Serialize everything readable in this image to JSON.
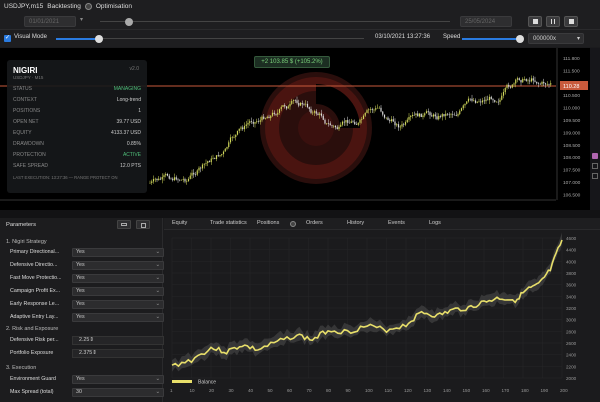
{
  "title": {
    "symbol": "USDJPY,m15",
    "mode": "Backtesting",
    "optimisation": "Optimisation"
  },
  "dates": {
    "start": "01/01/2021",
    "end": "25/05/2024"
  },
  "visual": {
    "label": "Visual Mode",
    "timestamp": "03/10/2021 13:27:36",
    "speed_label": "Speed",
    "speed_value": "000000x"
  },
  "chart": {
    "profit_badge": "+2 103.85 $ (+105.2%)",
    "price_labels": [
      "111.800",
      "111.500",
      "111.000",
      "110.500",
      "110.000",
      "109.500",
      "109.000",
      "108.500",
      "108.000",
      "107.500",
      "107.000",
      "106.500"
    ],
    "current_price": "110.28",
    "time_labels": [
      "2021",
      "",
      "",
      "",
      "",
      "",
      "",
      "",
      "",
      "12:00"
    ]
  },
  "info": {
    "name": "NIGIRI",
    "sub": "USDJPY · M15",
    "version": "v2.0",
    "rows": [
      {
        "k": "STATUS",
        "v": "MANAGING"
      },
      {
        "k": "CONTEXT",
        "v": "Long-trend"
      },
      {
        "k": "POSITIONS",
        "v": "1"
      },
      {
        "k": "OPEN NET",
        "v": "39.77 USD"
      },
      {
        "k": "EQUITY",
        "v": "4133.37 USD"
      },
      {
        "k": "DRAWDOWN",
        "v": "0.85%"
      },
      {
        "k": "PROTECTION",
        "v": "ACTIVE"
      },
      {
        "k": "SAFE SPREAD",
        "v": "12.0 PTS"
      }
    ],
    "footer": "LAST EXECUTION: 13:27:36 — RANGE PROTECT ON"
  },
  "params": {
    "title": "Parameters",
    "section1": "1. Nigiri Strategy",
    "rows1": [
      {
        "label": "Primary Directional...",
        "value": "Yes"
      },
      {
        "label": "Defensive Directio...",
        "value": "Yes"
      },
      {
        "label": "Fast Move Protectio...",
        "value": "Yes"
      },
      {
        "label": "Campaign Profit Ex...",
        "value": "Yes"
      },
      {
        "label": "Early Response Le...",
        "value": "Yes"
      },
      {
        "label": "Adaptive Entry Lay...",
        "value": "Yes"
      }
    ],
    "section2": "2. Risk and Exposure",
    "rows2": [
      {
        "label": "Defensive Risk per...",
        "value": "2.25"
      },
      {
        "label": "Portfolio Exposure",
        "value": "2.375"
      }
    ],
    "section3": "3. Execution",
    "rows3": [
      {
        "label": "Environment Guard",
        "value": "Yes"
      },
      {
        "label": "Max Spread (total)",
        "value": "30"
      }
    ]
  },
  "tabs": [
    "Equity",
    "Trade statistics",
    "Positions",
    "Orders",
    "History",
    "Events",
    "Logs"
  ],
  "equity": {
    "legend": "Balance",
    "y_labels": [
      "4600",
      "4400",
      "4000",
      "3800",
      "3600",
      "3400",
      "3200",
      "3000",
      "2800",
      "2600",
      "2400",
      "2200",
      "2000"
    ],
    "x_labels": [
      "1",
      "10",
      "20",
      "30",
      "40",
      "50",
      "60",
      "70",
      "80",
      "90",
      "100",
      "110",
      "120",
      "130",
      "140",
      "150",
      "160",
      "170",
      "180",
      "190",
      "200"
    ]
  },
  "colors": {
    "accent": "#2a7be0",
    "equity_line": "#e8df6a",
    "price_line": "#c85a3c",
    "candle_up": "#cfd65a",
    "candle_down": "#dddddd"
  }
}
